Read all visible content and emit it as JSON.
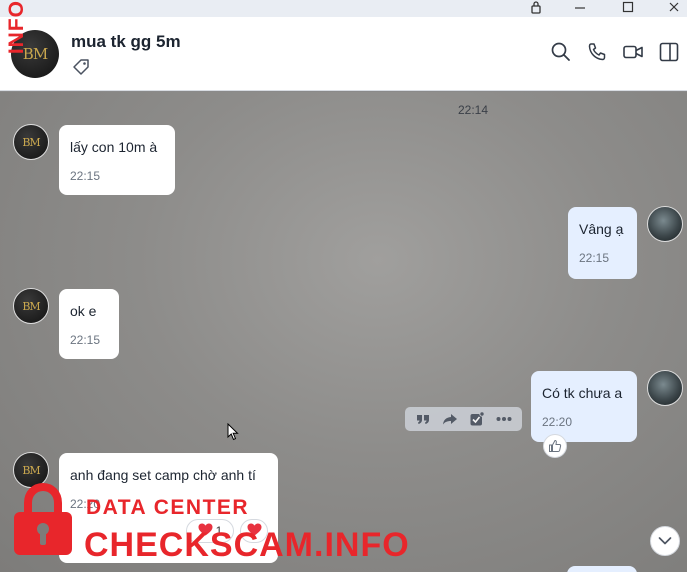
{
  "header": {
    "title": "mua tk gg 5m",
    "avatar_text": "BM"
  },
  "messages": [
    {
      "side": "in",
      "text": "lấy con 10m à",
      "time": "22:15"
    },
    {
      "side": "out",
      "text": "Vâng ạ",
      "time": "22:15"
    },
    {
      "side": "in",
      "text": "ok e",
      "time": "22:15"
    },
    {
      "side": "out",
      "text": "Có tk chưa a",
      "time": "22:20"
    },
    {
      "side": "in",
      "text": "anh đang set camp chờ anh tí",
      "time": "22:20"
    }
  ],
  "top_time": "22:14",
  "reactions": {
    "heart_count": "1"
  },
  "watermark": {
    "side": "INFO",
    "line1": "DATA CENTER",
    "line2": "CHECKSCAM.INFO"
  },
  "colors": {
    "accent": "#e8262b",
    "my_bubble": "#e5efff",
    "their_bubble": "#ffffff"
  }
}
